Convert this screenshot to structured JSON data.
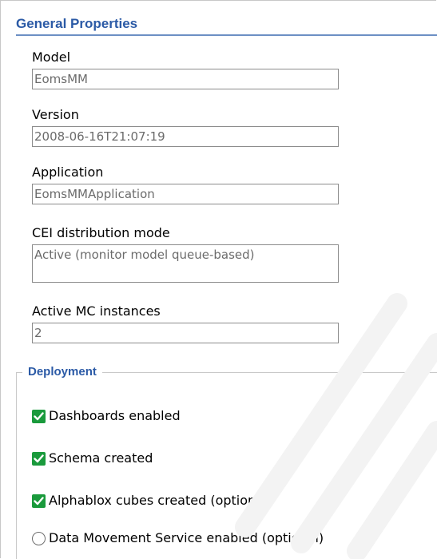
{
  "section": {
    "title": "General Properties"
  },
  "fields": {
    "model": {
      "label": "Model",
      "value": "EomsMM"
    },
    "version": {
      "label": "Version",
      "value": "2008-06-16T21:07:19"
    },
    "application": {
      "label": "Application",
      "value": "EomsMMApplication"
    },
    "cei_mode": {
      "label": "CEI distribution mode",
      "value": "Active (monitor model queue-based)"
    },
    "active_mc": {
      "label": "Active MC instances",
      "value": "2"
    }
  },
  "deployment": {
    "legend": "Deployment",
    "items": [
      {
        "label": "Dashboards enabled",
        "control": "checkbox",
        "checked": true
      },
      {
        "label": "Schema created",
        "control": "checkbox",
        "checked": true
      },
      {
        "label": "Alphablox cubes created (optional)",
        "control": "checkbox",
        "checked": true
      },
      {
        "label": "Data Movement Service enabled (optional)",
        "control": "radio",
        "checked": false
      }
    ]
  },
  "colors": {
    "header_text": "#2b5aa6",
    "header_rule": "#6c8fc4",
    "checkbox_fill": "#1a9a3c",
    "field_text": "#6b6b6b"
  },
  "icons": {
    "check": "checkmark-icon",
    "radio": "radio-empty-icon"
  }
}
